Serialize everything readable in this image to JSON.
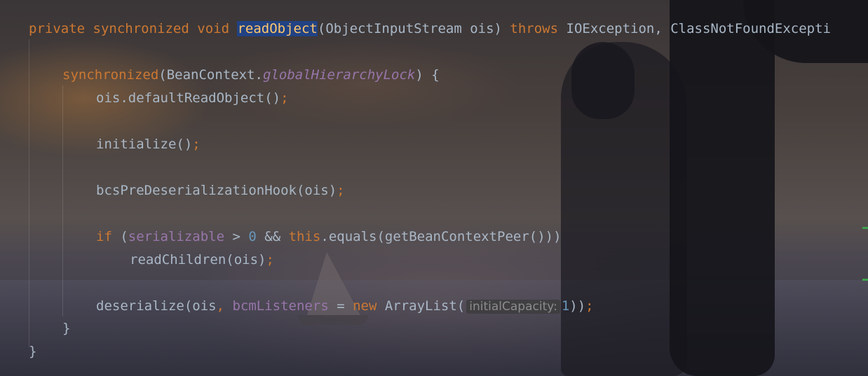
{
  "editor": {
    "line1": {
      "kw_private": "private",
      "kw_synchronized": "synchronized",
      "kw_void": "void",
      "method": "readObject",
      "params": "(ObjectInputStream ois) ",
      "kw_throws": "throws",
      "exceptions": " IOException, ClassNotFoundExcepti"
    },
    "line2": {
      "kw_synchronized": "synchronized",
      "prefix": "(BeanContext.",
      "field": "globalHierarchyLock",
      "suffix": ") {"
    },
    "line3": {
      "code": "ois.defaultReadObject()",
      "semi": ";"
    },
    "line4": {
      "code": "initialize()",
      "semi": ";"
    },
    "line5": {
      "code": "bcsPreDeserializationHook(ois)",
      "semi": ";"
    },
    "line6": {
      "kw_if": "if",
      "open": " (",
      "field": "serializable",
      "op": " > ",
      "zero": "0",
      "and": " && ",
      "kw_this": "this",
      "rest": ".equals(getBeanContextPeer()))"
    },
    "line7": {
      "code": "readChildren(ois)",
      "semi": ";"
    },
    "line8": {
      "prefix": "deserialize(ois",
      "comma": ", ",
      "field": "bcmListeners",
      "eq": " = ",
      "kw_new": "new",
      "type": " ArrayList(",
      "hint": "initialCapacity:",
      "one": "1",
      "close": "))",
      "semi": ";"
    },
    "line9": {
      "brace": "}"
    },
    "line10": {
      "brace": "}"
    }
  }
}
